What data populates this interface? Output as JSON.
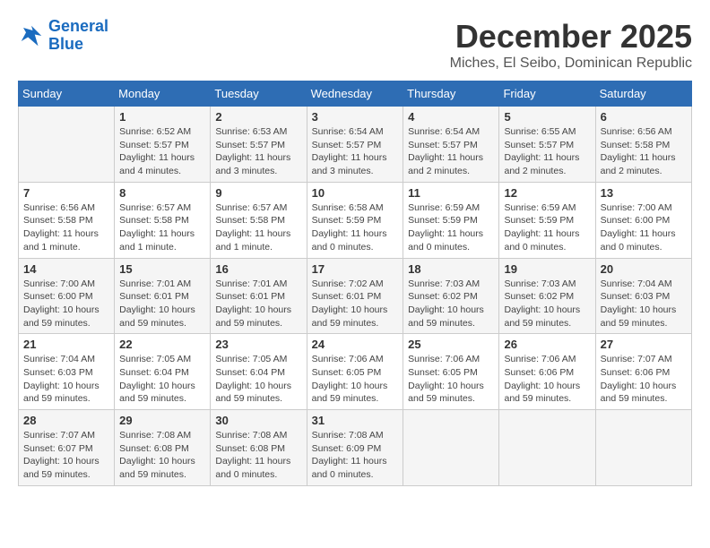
{
  "logo": {
    "line1": "General",
    "line2": "Blue"
  },
  "title": "December 2025",
  "location": "Miches, El Seibo, Dominican Republic",
  "days_header": [
    "Sunday",
    "Monday",
    "Tuesday",
    "Wednesday",
    "Thursday",
    "Friday",
    "Saturday"
  ],
  "weeks": [
    [
      {
        "day": "",
        "info": ""
      },
      {
        "day": "1",
        "info": "Sunrise: 6:52 AM\nSunset: 5:57 PM\nDaylight: 11 hours\nand 4 minutes."
      },
      {
        "day": "2",
        "info": "Sunrise: 6:53 AM\nSunset: 5:57 PM\nDaylight: 11 hours\nand 3 minutes."
      },
      {
        "day": "3",
        "info": "Sunrise: 6:54 AM\nSunset: 5:57 PM\nDaylight: 11 hours\nand 3 minutes."
      },
      {
        "day": "4",
        "info": "Sunrise: 6:54 AM\nSunset: 5:57 PM\nDaylight: 11 hours\nand 2 minutes."
      },
      {
        "day": "5",
        "info": "Sunrise: 6:55 AM\nSunset: 5:57 PM\nDaylight: 11 hours\nand 2 minutes."
      },
      {
        "day": "6",
        "info": "Sunrise: 6:56 AM\nSunset: 5:58 PM\nDaylight: 11 hours\nand 2 minutes."
      }
    ],
    [
      {
        "day": "7",
        "info": "Sunrise: 6:56 AM\nSunset: 5:58 PM\nDaylight: 11 hours\nand 1 minute."
      },
      {
        "day": "8",
        "info": "Sunrise: 6:57 AM\nSunset: 5:58 PM\nDaylight: 11 hours\nand 1 minute."
      },
      {
        "day": "9",
        "info": "Sunrise: 6:57 AM\nSunset: 5:58 PM\nDaylight: 11 hours\nand 1 minute."
      },
      {
        "day": "10",
        "info": "Sunrise: 6:58 AM\nSunset: 5:59 PM\nDaylight: 11 hours\nand 0 minutes."
      },
      {
        "day": "11",
        "info": "Sunrise: 6:59 AM\nSunset: 5:59 PM\nDaylight: 11 hours\nand 0 minutes."
      },
      {
        "day": "12",
        "info": "Sunrise: 6:59 AM\nSunset: 5:59 PM\nDaylight: 11 hours\nand 0 minutes."
      },
      {
        "day": "13",
        "info": "Sunrise: 7:00 AM\nSunset: 6:00 PM\nDaylight: 11 hours\nand 0 minutes."
      }
    ],
    [
      {
        "day": "14",
        "info": "Sunrise: 7:00 AM\nSunset: 6:00 PM\nDaylight: 10 hours\nand 59 minutes."
      },
      {
        "day": "15",
        "info": "Sunrise: 7:01 AM\nSunset: 6:01 PM\nDaylight: 10 hours\nand 59 minutes."
      },
      {
        "day": "16",
        "info": "Sunrise: 7:01 AM\nSunset: 6:01 PM\nDaylight: 10 hours\nand 59 minutes."
      },
      {
        "day": "17",
        "info": "Sunrise: 7:02 AM\nSunset: 6:01 PM\nDaylight: 10 hours\nand 59 minutes."
      },
      {
        "day": "18",
        "info": "Sunrise: 7:03 AM\nSunset: 6:02 PM\nDaylight: 10 hours\nand 59 minutes."
      },
      {
        "day": "19",
        "info": "Sunrise: 7:03 AM\nSunset: 6:02 PM\nDaylight: 10 hours\nand 59 minutes."
      },
      {
        "day": "20",
        "info": "Sunrise: 7:04 AM\nSunset: 6:03 PM\nDaylight: 10 hours\nand 59 minutes."
      }
    ],
    [
      {
        "day": "21",
        "info": "Sunrise: 7:04 AM\nSunset: 6:03 PM\nDaylight: 10 hours\nand 59 minutes."
      },
      {
        "day": "22",
        "info": "Sunrise: 7:05 AM\nSunset: 6:04 PM\nDaylight: 10 hours\nand 59 minutes."
      },
      {
        "day": "23",
        "info": "Sunrise: 7:05 AM\nSunset: 6:04 PM\nDaylight: 10 hours\nand 59 minutes."
      },
      {
        "day": "24",
        "info": "Sunrise: 7:06 AM\nSunset: 6:05 PM\nDaylight: 10 hours\nand 59 minutes."
      },
      {
        "day": "25",
        "info": "Sunrise: 7:06 AM\nSunset: 6:05 PM\nDaylight: 10 hours\nand 59 minutes."
      },
      {
        "day": "26",
        "info": "Sunrise: 7:06 AM\nSunset: 6:06 PM\nDaylight: 10 hours\nand 59 minutes."
      },
      {
        "day": "27",
        "info": "Sunrise: 7:07 AM\nSunset: 6:06 PM\nDaylight: 10 hours\nand 59 minutes."
      }
    ],
    [
      {
        "day": "28",
        "info": "Sunrise: 7:07 AM\nSunset: 6:07 PM\nDaylight: 10 hours\nand 59 minutes."
      },
      {
        "day": "29",
        "info": "Sunrise: 7:08 AM\nSunset: 6:08 PM\nDaylight: 10 hours\nand 59 minutes."
      },
      {
        "day": "30",
        "info": "Sunrise: 7:08 AM\nSunset: 6:08 PM\nDaylight: 11 hours\nand 0 minutes."
      },
      {
        "day": "31",
        "info": "Sunrise: 7:08 AM\nSunset: 6:09 PM\nDaylight: 11 hours\nand 0 minutes."
      },
      {
        "day": "",
        "info": ""
      },
      {
        "day": "",
        "info": ""
      },
      {
        "day": "",
        "info": ""
      }
    ]
  ]
}
